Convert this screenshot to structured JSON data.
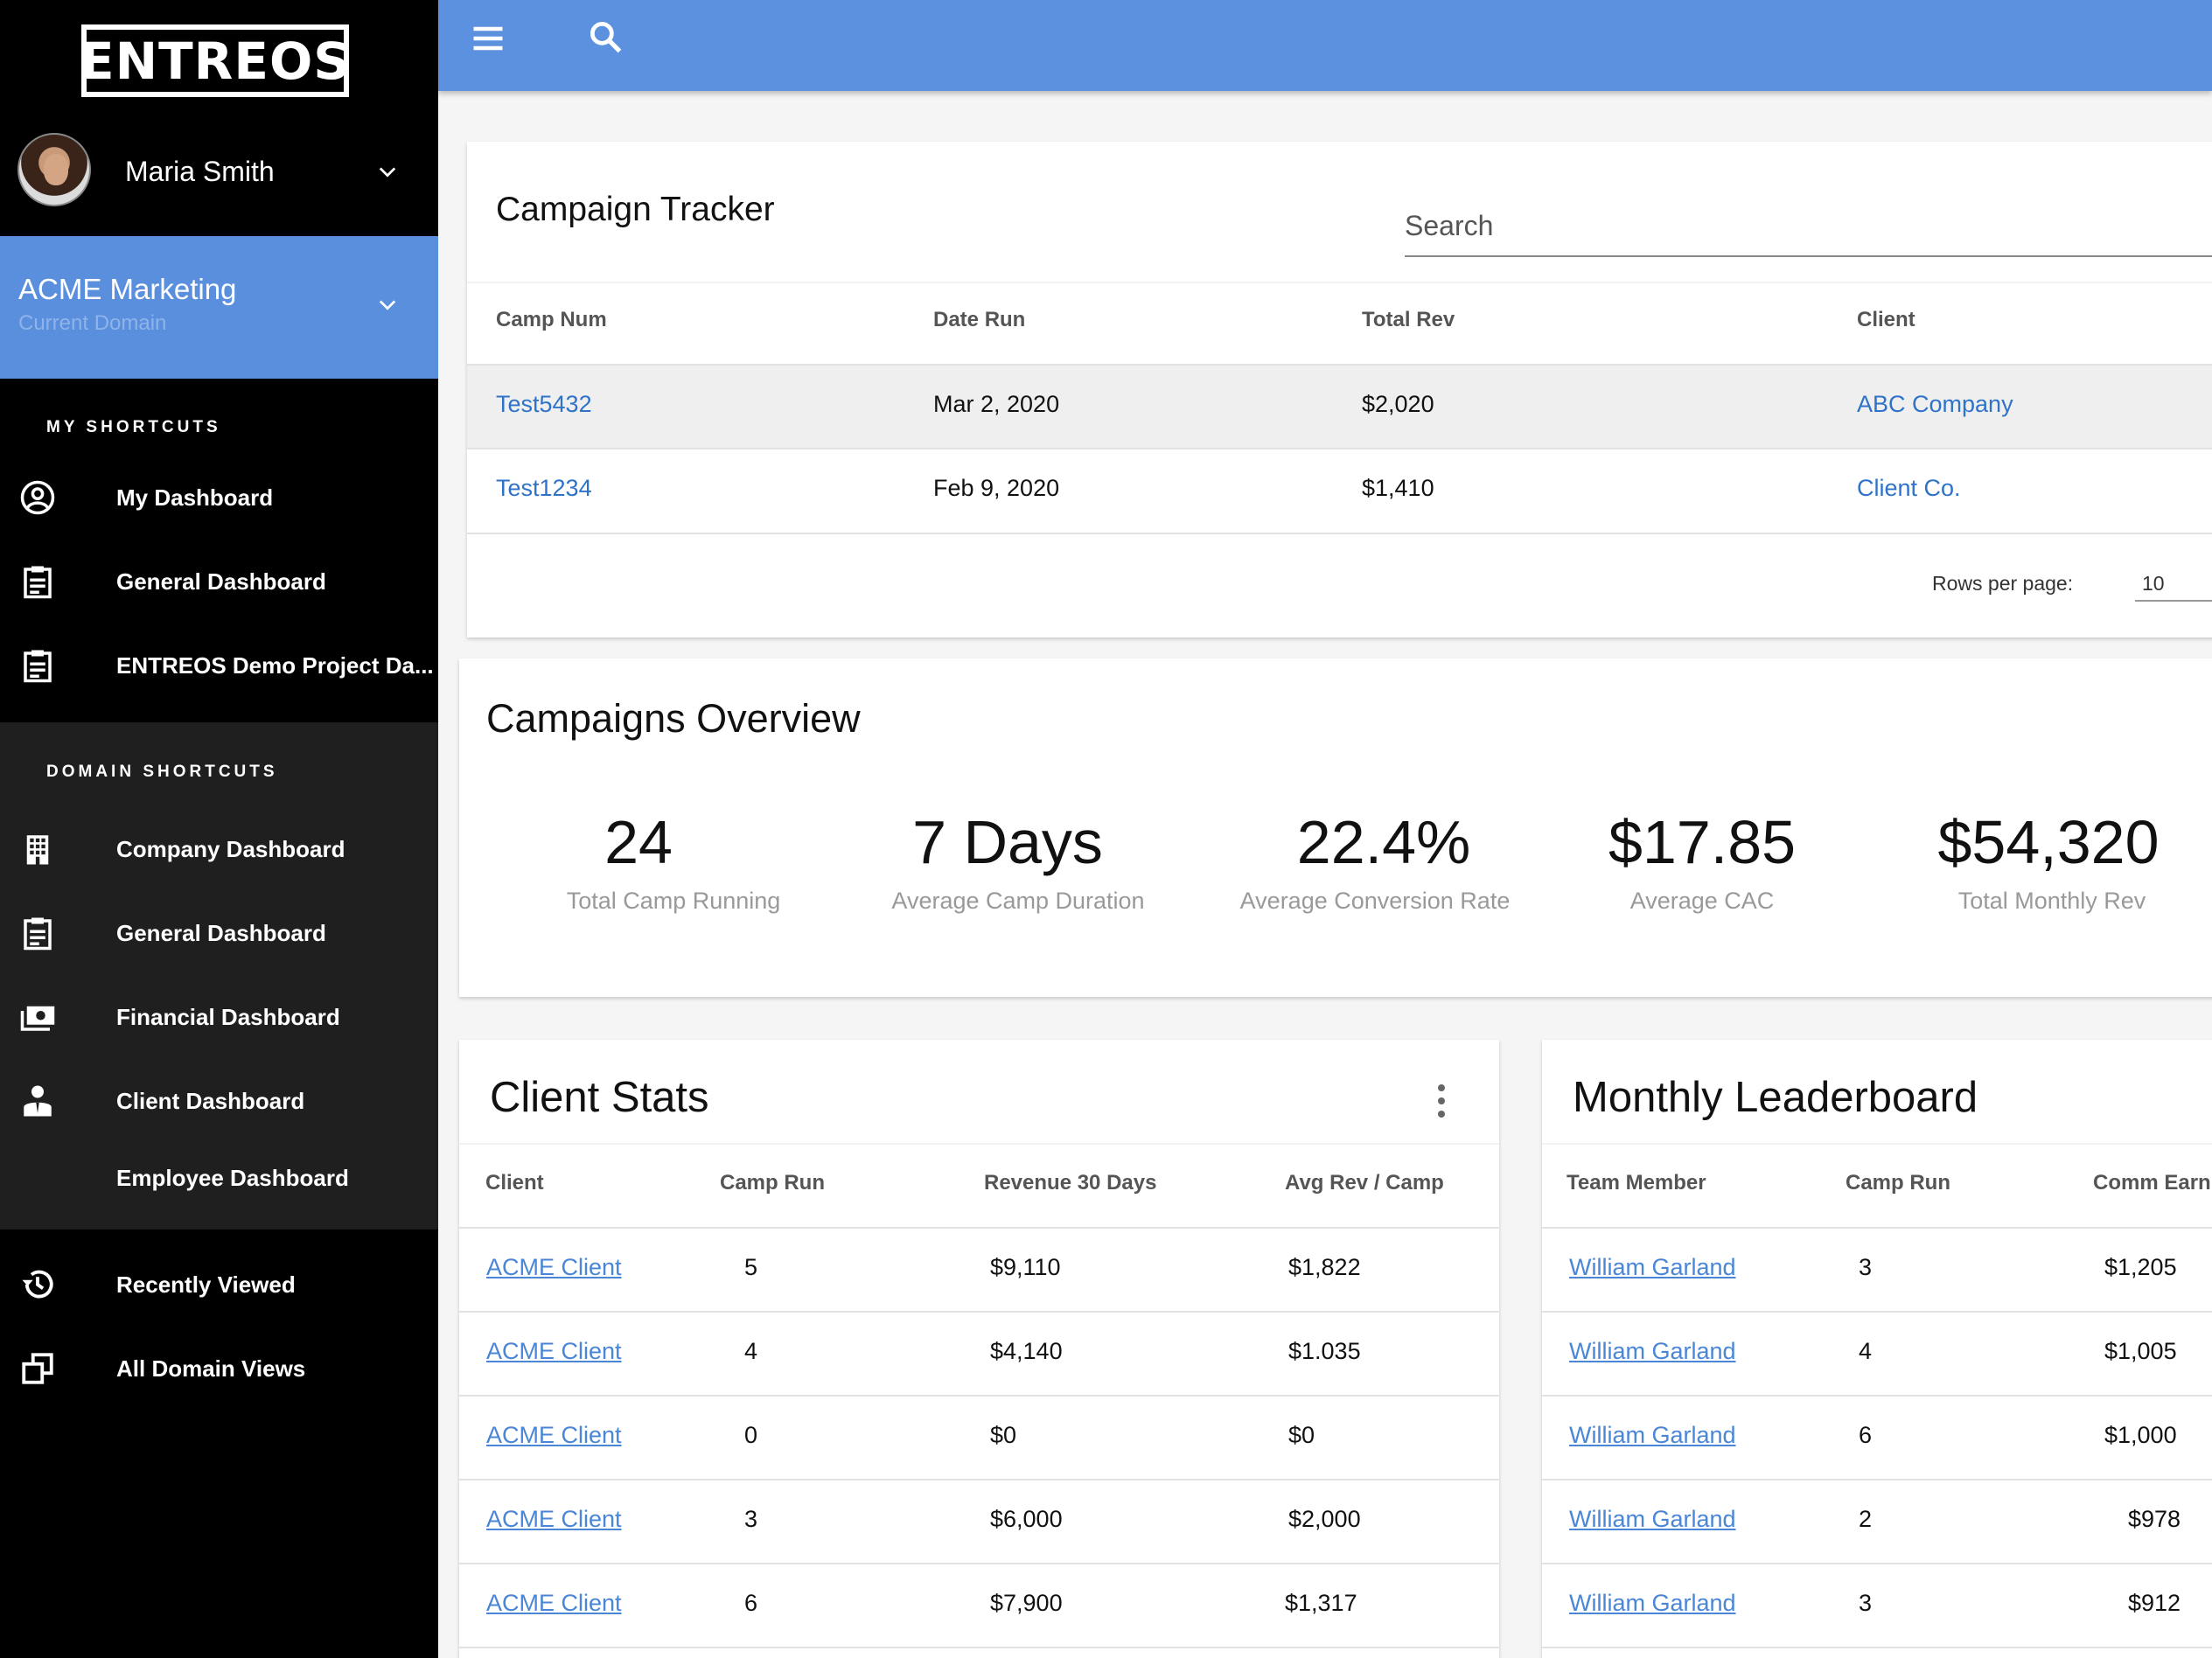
{
  "brand": {
    "logo_text": "ENTREOS"
  },
  "user": {
    "name": "Maria Smith"
  },
  "domain": {
    "name": "ACME Marketing",
    "subtitle": "Current Domain"
  },
  "shortcuts": {
    "title": "MY SHORTCUTS",
    "items": [
      {
        "label": "My Dashboard",
        "icon": "user-circle-icon"
      },
      {
        "label": "General Dashboard",
        "icon": "clipboard-icon"
      },
      {
        "label": "ENTREOS Demo Project Da...",
        "icon": "clipboard-icon"
      }
    ]
  },
  "domain_shortcuts": {
    "title": "DOMAIN SHORTCUTS",
    "items": [
      {
        "label": "Company Dashboard",
        "icon": "building-icon"
      },
      {
        "label": "General Dashboard",
        "icon": "clipboard-icon"
      },
      {
        "label": "Financial Dashboard",
        "icon": "money-icon"
      },
      {
        "label": "Client Dashboard",
        "icon": "person-icon"
      },
      {
        "label": "Employee Dashboard",
        "icon": ""
      }
    ]
  },
  "bottom_nav": {
    "items": [
      {
        "label": "Recently Viewed",
        "icon": "history-icon"
      },
      {
        "label": "All Domain Views",
        "icon": "windows-icon"
      }
    ]
  },
  "campaign_tracker": {
    "title": "Campaign Tracker",
    "search_placeholder": "Search",
    "columns": [
      "Camp Num",
      "Date Run",
      "Total Rev",
      "Client"
    ],
    "rows": [
      {
        "camp_num": "Test5432",
        "date_run": "Mar 2, 2020",
        "total_rev": "$2,020",
        "client": "ABC Company"
      },
      {
        "camp_num": "Test1234",
        "date_run": "Feb 9, 2020",
        "total_rev": "$1,410",
        "client": "Client Co."
      }
    ],
    "rows_per_page_label": "Rows per page:",
    "rows_per_page_value": "10"
  },
  "campaigns_overview": {
    "title": "Campaigns Overview",
    "stats": [
      {
        "value": "24",
        "label": "Total Camp Running"
      },
      {
        "value": "7 Days",
        "label": "Average Camp Duration"
      },
      {
        "value": "22.4%",
        "label": "Average Conversion Rate"
      },
      {
        "value": "$17.85",
        "label": "Average CAC"
      },
      {
        "value": "$54,320",
        "label": "Total Monthly Rev"
      }
    ]
  },
  "client_stats": {
    "title": "Client Stats",
    "columns": [
      "Client",
      "Camp Run",
      "Revenue 30 Days",
      "Avg Rev / Camp"
    ],
    "rows": [
      {
        "client": "ACME Client",
        "camp_run": "5",
        "revenue": "$9,110",
        "avg": "$1,822"
      },
      {
        "client": "ACME Client",
        "camp_run": "4",
        "revenue": "$4,140",
        "avg": "$1.035"
      },
      {
        "client": "ACME Client",
        "camp_run": "0",
        "revenue": "$0",
        "avg": "$0"
      },
      {
        "client": "ACME Client",
        "camp_run": "3",
        "revenue": "$6,000",
        "avg": "$2,000"
      },
      {
        "client": "ACME Client",
        "camp_run": "6",
        "revenue": "$7,900",
        "avg": "$1,317"
      }
    ]
  },
  "leaderboard": {
    "title": "Monthly Leaderboard",
    "columns": [
      "Team Member",
      "Camp Run",
      "Comm Earn"
    ],
    "rows": [
      {
        "member": "William Garland",
        "camp_run": "3",
        "comm": "$1,205"
      },
      {
        "member": "William Garland",
        "camp_run": "4",
        "comm": "$1,005"
      },
      {
        "member": "William Garland",
        "camp_run": "6",
        "comm": "$1,000"
      },
      {
        "member": "William Garland",
        "camp_run": "2",
        "comm": "$978"
      },
      {
        "member": "William Garland",
        "camp_run": "3",
        "comm": "$912"
      }
    ]
  },
  "colors": {
    "accent": "#5b91df",
    "link": "#2f73c9",
    "sidebar": "#000000"
  }
}
